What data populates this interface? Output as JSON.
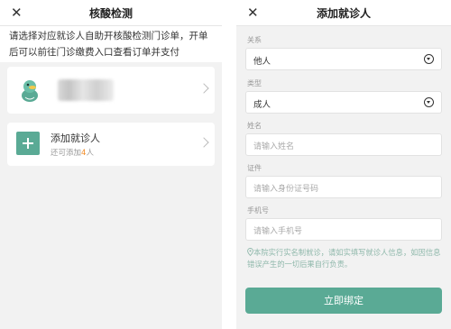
{
  "left": {
    "header": {
      "title": "核酸检测"
    },
    "notice": "请选择对应就诊人自助开核酸检测门诊单，开单后可以前往门诊缴费入口查看订单并支付",
    "add_card": {
      "title": "添加就诊人",
      "sub_prefix": "还可添加",
      "sub_count": "4",
      "sub_suffix": "人"
    }
  },
  "right": {
    "header": {
      "title": "添加就诊人"
    },
    "relation": {
      "label": "关系",
      "value": "他人"
    },
    "type": {
      "label": "类型",
      "value": "成人"
    },
    "name": {
      "label": "姓名",
      "placeholder": "请输入姓名"
    },
    "id": {
      "label": "证件",
      "placeholder": "请输入身份证号码"
    },
    "phone": {
      "label": "手机号",
      "placeholder": "请输入手机号"
    },
    "hint": "本院实行实名制就诊，请如实填写就诊人信息，如因信息错误产生的一切后果自行负责。",
    "submit_label": "立即绑定"
  },
  "colors": {
    "accent": "#5aaa95",
    "count_highlight": "#f08a24",
    "hint_text": "#8fb8ab"
  },
  "icons": [
    "close-icon",
    "chevron-right-icon",
    "duck-avatar-icon",
    "plus-icon",
    "dropdown-icon",
    "location-pin-icon"
  ]
}
